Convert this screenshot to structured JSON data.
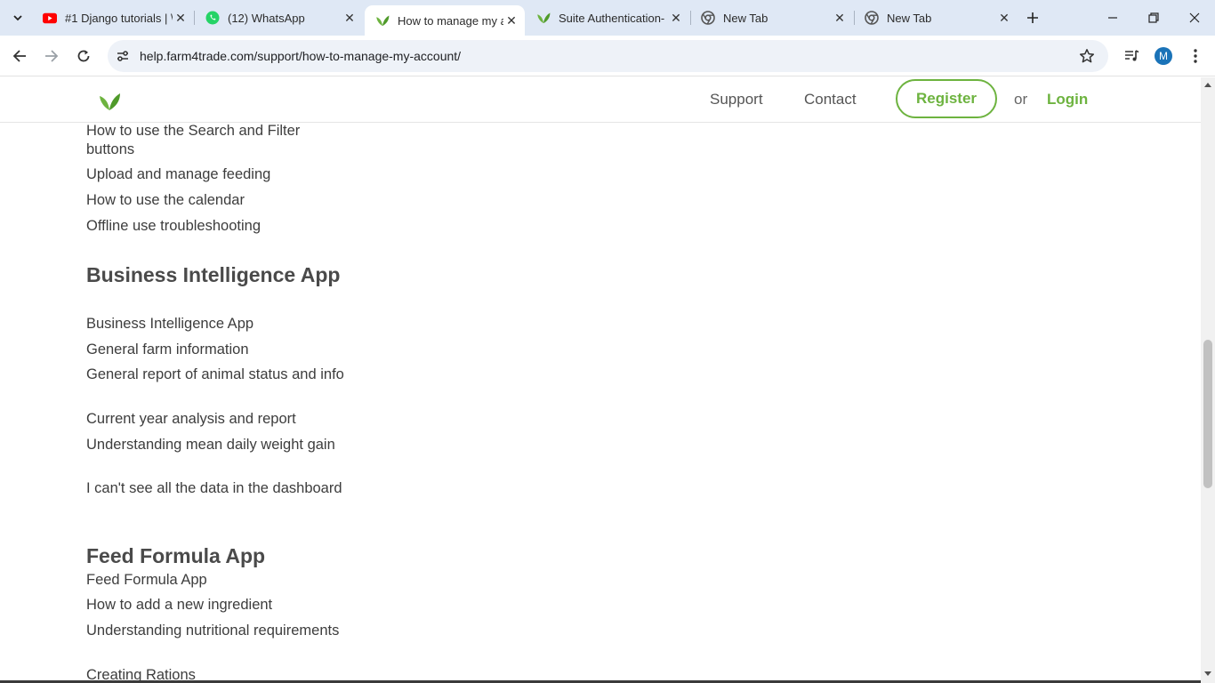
{
  "browser": {
    "tabs": [
      {
        "title": "#1 Django tutorials | \\",
        "favicon": "youtube-icon",
        "active": false
      },
      {
        "title": "(12) WhatsApp",
        "favicon": "whatsapp-icon",
        "active": false
      },
      {
        "title": "How to manage my a",
        "favicon": "farm4trade-leaf-icon",
        "active": true
      },
      {
        "title": "Suite Authentication-",
        "favicon": "farm4trade-leaf-icon",
        "active": false
      },
      {
        "title": "New Tab",
        "favicon": "chrome-icon",
        "active": false
      },
      {
        "title": "New Tab",
        "favicon": "chrome-icon",
        "active": false
      }
    ],
    "url": "help.farm4trade.com/support/how-to-manage-my-account/",
    "profile_initial": "M",
    "accent_color": "#1a73b8"
  },
  "site": {
    "brand_color": "#6db33f",
    "nav": {
      "support": "Support",
      "contact": "Contact",
      "register": "Register",
      "or": "or",
      "login": "Login"
    },
    "sections": [
      {
        "title": "",
        "links": [
          "How to use the Search and Filter buttons",
          "Upload and manage feeding",
          "How to use the calendar",
          "Offline use troubleshooting"
        ]
      },
      {
        "title": "Business Intelligence App",
        "links": [
          "Business Intelligence App",
          "General farm information",
          "General report of animal status and info",
          "Current year analysis and report",
          "Understanding mean daily weight gain",
          "I can't see all the data in the dashboard"
        ]
      },
      {
        "title": "Feed Formula App",
        "links": [
          "Feed Formula App",
          "How to add a new ingredient",
          "Understanding nutritional requirements",
          "Creating Rations"
        ]
      }
    ]
  }
}
